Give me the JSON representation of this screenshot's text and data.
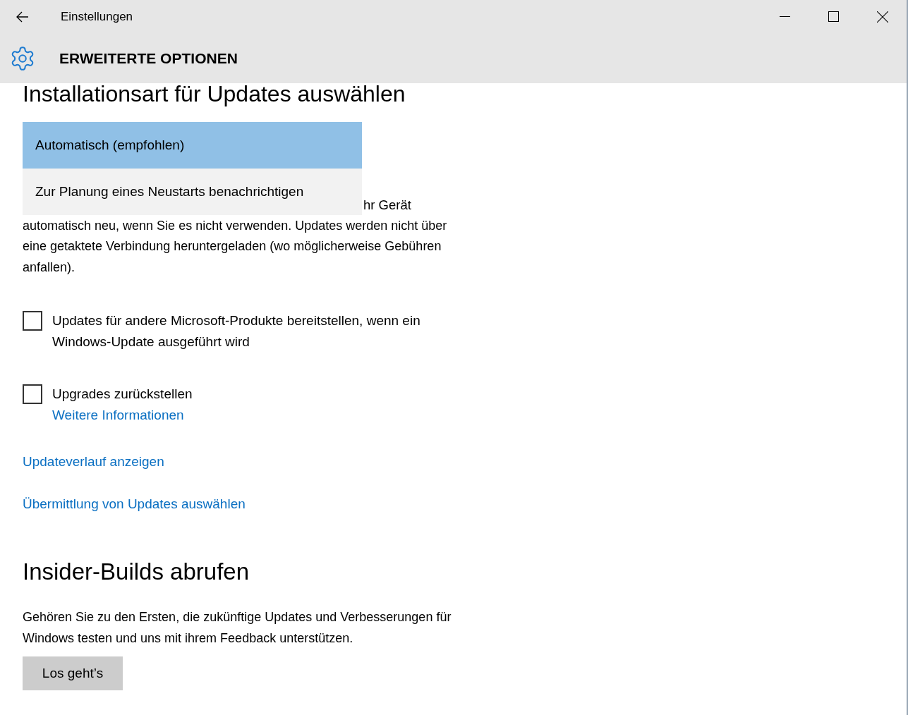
{
  "window": {
    "title": "Einstellungen"
  },
  "page_title": "ERWEITERTE OPTIONEN",
  "install_section": {
    "heading": "Installationsart für Updates auswählen",
    "dropdown_options": [
      {
        "label": "Automatisch (empfohlen)",
        "selected": true
      },
      {
        "label": "Zur Planung eines Neustarts benachrichtigen",
        "selected": false
      }
    ],
    "description_fragment": "hr Gerät",
    "description": "automatisch neu, wenn Sie es nicht verwenden. Updates werden nicht über eine getaktete Verbindung heruntergeladen (wo möglicherweise Gebühren anfallen)."
  },
  "options": [
    {
      "label": "Updates für andere Microsoft-Produkte bereitstellen, wenn ein Windows-Update ausgeführt wird",
      "checked": false
    },
    {
      "label": "Upgrades zurückstellen",
      "checked": false,
      "link": "Weitere Informationen"
    }
  ],
  "links": [
    "Updateverlauf anzeigen",
    "Übermittlung von Updates auswählen"
  ],
  "insider_section": {
    "heading": "Insider-Builds abrufen",
    "description": "Gehören Sie zu den Ersten, die zukünftige Updates und Verbesserungen für Windows testen und uns mit ihrem Feedback unterstützen.",
    "button": "Los geht’s"
  }
}
